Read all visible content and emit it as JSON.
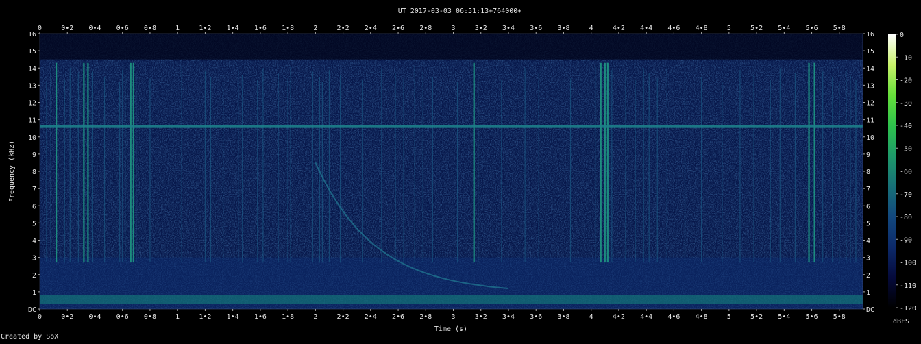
{
  "window": {
    "title": "UT 2017-03-03 06:51:13+764000+"
  },
  "footer": {
    "credit": "Created by SoX"
  },
  "chart_data": {
    "type": "heatmap",
    "subtype": "spectrogram",
    "title": "UT 2017-03-03 06:51:13+764000+",
    "xlabel": "Time (s)",
    "ylabel": "Frequency (kHz)",
    "xlim": [
      0,
      5.97
    ],
    "ylim": [
      0,
      16
    ],
    "x_ticks": [
      "0",
      "0•2",
      "0•4",
      "0•6",
      "0•8",
      "1",
      "1•2",
      "1•4",
      "1•6",
      "1•8",
      "2",
      "2•2",
      "2•4",
      "2•6",
      "2•8",
      "3",
      "3•2",
      "3•4",
      "3•6",
      "3•8",
      "4",
      "4•2",
      "4•4",
      "4•6",
      "4•8",
      "5",
      "5•2",
      "5•4",
      "5•6",
      "5•8"
    ],
    "x_tick_values": [
      0,
      0.2,
      0.4,
      0.6,
      0.8,
      1,
      1.2,
      1.4,
      1.6,
      1.8,
      2,
      2.2,
      2.4,
      2.6,
      2.8,
      3,
      3.2,
      3.4,
      3.6,
      3.8,
      4,
      4.2,
      4.4,
      4.6,
      4.8,
      5,
      5.2,
      5.4,
      5.6,
      5.8
    ],
    "y_ticks": [
      "DC",
      "1",
      "2",
      "3",
      "4",
      "5",
      "6",
      "7",
      "8",
      "9",
      "10",
      "11",
      "12",
      "13",
      "14",
      "15",
      "16"
    ],
    "y_tick_values": [
      0,
      1,
      2,
      3,
      4,
      5,
      6,
      7,
      8,
      9,
      10,
      11,
      12,
      13,
      14,
      15,
      16
    ],
    "colorbar": {
      "label": "dBFS",
      "ticks": [
        "0",
        "-10",
        "-20",
        "-30",
        "-40",
        "-50",
        "-60",
        "-70",
        "-80",
        "-90",
        "-100",
        "-110",
        "-120"
      ],
      "tick_values": [
        0,
        -10,
        -20,
        -30,
        -40,
        -50,
        -60,
        -70,
        -80,
        -90,
        -100,
        -110,
        -120
      ],
      "range": [
        -120,
        0
      ],
      "colors": [
        "#000000",
        "#050a3c",
        "#0c2a6a",
        "#12487e",
        "#177078",
        "#1e9a6a",
        "#2ec24c",
        "#66de3a",
        "#c8f26a",
        "#ffffff"
      ]
    },
    "features": {
      "tone_line_khz": 10.6,
      "low_band_khz": [
        0.3,
        0.8
      ],
      "whistler": {
        "start_time_s": 2.0,
        "start_freq_khz": 8.5,
        "end_time_s": 3.4,
        "end_freq_khz": 0.9
      },
      "sferic_times_s": [
        0.05,
        0.08,
        0.12,
        0.18,
        0.22,
        0.28,
        0.32,
        0.35,
        0.38,
        0.47,
        0.58,
        0.6,
        0.62,
        0.66,
        0.68,
        0.7,
        0.8,
        1.03,
        1.2,
        1.24,
        1.33,
        1.44,
        1.47,
        1.58,
        1.62,
        1.73,
        1.8,
        1.82,
        1.98,
        2.03,
        2.05,
        2.1,
        2.18,
        2.34,
        2.48,
        2.58,
        2.64,
        2.72,
        2.78,
        2.85,
        3.03,
        3.15,
        3.18,
        3.35,
        3.52,
        3.62,
        3.85,
        4.03,
        4.07,
        4.1,
        4.12,
        4.15,
        4.25,
        4.32,
        4.38,
        4.42,
        4.48,
        4.55,
        4.68,
        4.8,
        4.95,
        5.08,
        5.18,
        5.3,
        5.37,
        5.48,
        5.58,
        5.62,
        5.68,
        5.75,
        5.8,
        5.85,
        5.88,
        5.92
      ],
      "strong_sferic_times_s": [
        0.12,
        0.32,
        0.35,
        0.66,
        0.68,
        3.15,
        4.07,
        4.1,
        4.12,
        5.58,
        5.62,
        5.9
      ]
    }
  }
}
